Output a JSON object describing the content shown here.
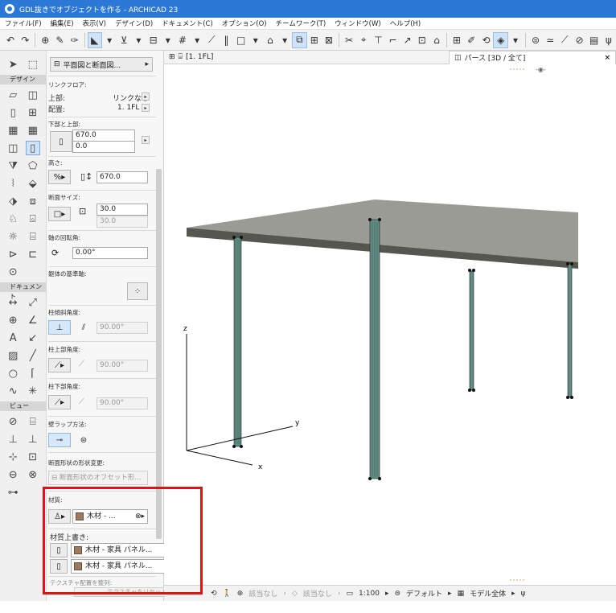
{
  "window": {
    "title": "GDL抜きでオブジェクトを作る - ARCHICAD 23"
  },
  "menu": [
    "ファイル(F)",
    "編集(E)",
    "表示(V)",
    "デザイン(D)",
    "ドキュメント(C)",
    "オプション(O)",
    "チームワーク(T)",
    "ウィンドウ(W)",
    "ヘルプ(H)"
  ],
  "toolbox": {
    "design_label": "デザイン",
    "document_label": "ドキュメント",
    "view_label": "ビュー"
  },
  "info": {
    "header_button": "平面図と断面図...",
    "link_floor_label": "リンクフロア:",
    "top_label": "上部:",
    "top_value": "リンクなし",
    "placement_label": "配置:",
    "placement_value": "1. 1FL",
    "bottom_top_label": "下部と上部:",
    "top_offset": "670.0",
    "bottom_offset": "0.0",
    "height_label": "高さ:",
    "height_value": "670.0",
    "section_size_label": "断面サイズ:",
    "section_w": "30.0",
    "section_h": "30.0",
    "axis_rotation_label": "軸の回転角:",
    "axis_rotation_value": "0.00°",
    "ref_axis_label": "躯体の基準軸:",
    "slant_label": "柱傾斜角度:",
    "slant_value": "90.00°",
    "top_angle_label": "柱上部角度:",
    "top_angle_value": "90.00°",
    "bottom_angle_label": "柱下部角度:",
    "bottom_angle_value": "90.00°",
    "wrap_label": "壁ラップ方法:",
    "shape_change_label": "断面形状の形状変更:",
    "offset_shape_button": "断面形状のオフセット形...",
    "material_label": "材質:",
    "material_value": "木材 - ...",
    "override_label": "材質上書き:",
    "override1": "木材 - 家具 パネル...",
    "override2": "木材 - 家具 パネル...",
    "texture_label": "テクスチャ配置を整列:",
    "texture_reset": "テクスチャをリセット",
    "material_color": "#9b7a5e"
  },
  "tabs": {
    "plan": "[1. 1FL]",
    "perspective": "パース [3D / 全て]",
    "close": "×"
  },
  "axes": {
    "x": "x",
    "y": "y",
    "z": "z"
  },
  "status": {
    "none1": "該当なし",
    "none2": "該当なし",
    "scale": "1:100",
    "layer": "デフォルト",
    "model": "モデル全体"
  }
}
